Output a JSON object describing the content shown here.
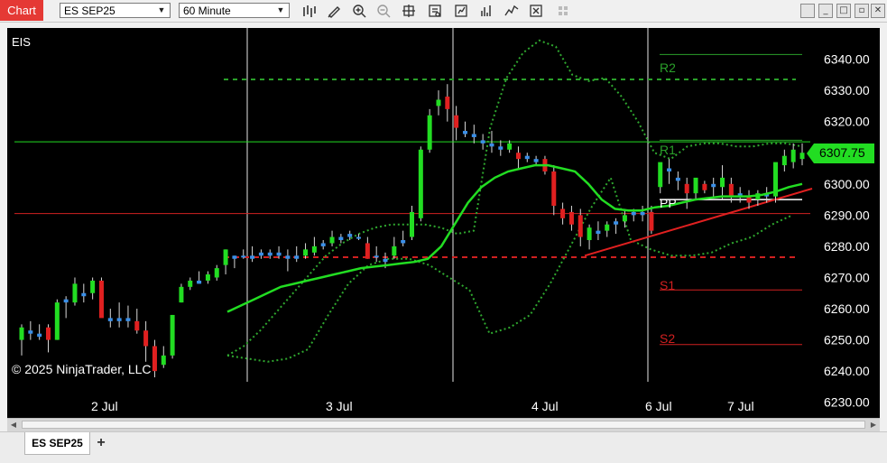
{
  "toolbar": {
    "chart_label": "Chart",
    "instrument": "ES SEP25",
    "interval": "60 Minute",
    "icons": [
      "bar-type-icon",
      "pencil-drawing-icon",
      "zoom-in-icon",
      "zoom-out-icon",
      "crosshair-icon",
      "data-box-icon",
      "strategies-icon",
      "indicators-icon",
      "chart-trader-icon",
      "properties-icon",
      "window-link-icon"
    ]
  },
  "window_controls": {
    "minimize": "_",
    "maximize": "□",
    "close": "✕"
  },
  "chart": {
    "instrument_label": "EIS",
    "copyright": "© 2025 NinjaTrader, LLC",
    "current_price_label": "6307.75",
    "pivot_labels": {
      "r2": "R2",
      "r1": "R1",
      "pp": "PP",
      "s1": "S1",
      "s2": "S2"
    },
    "pivot_levels": {
      "r2": 6341.5,
      "r1": 6314,
      "pp": 6295,
      "s1": 6266,
      "s2": 6248.5
    },
    "horizontal_lines": {
      "green_dashed": 6333.5,
      "green_solid": 6313.5,
      "red_solid": 6290.5,
      "red_dashed": 6276.5
    },
    "price_ticks": [
      "6340.00",
      "6330.00",
      "6320.00",
      "6310.00",
      "6300.00",
      "6290.00",
      "6280.00",
      "6270.00",
      "6260.00",
      "6250.00",
      "6240.00",
      "6230.00"
    ],
    "date_labels": [
      "2 Jul",
      "3 Jul",
      "4 Jul",
      "6 Jul",
      "7 Jul"
    ],
    "colors": {
      "up": "#22dd22",
      "down": "#e02020",
      "doji": "#3a8fe8",
      "ma": "#22dd22",
      "band": "#2fa82f",
      "pivot_green": "#2aa02a",
      "pivot_red": "#d02020",
      "support": "#e02020"
    }
  },
  "chart_data": {
    "type": "candlestick",
    "y_axis": {
      "min": 6225,
      "max": 6350
    },
    "bars": [
      [
        6250,
        6255,
        6245,
        6254
      ],
      [
        6253,
        6256,
        6250,
        6252
      ],
      [
        6252,
        6255,
        6250,
        6251
      ],
      [
        6254,
        6255,
        6246,
        6250
      ],
      [
        6250,
        6263,
        6250,
        6262
      ],
      [
        6262,
        6264,
        6257,
        6263
      ],
      [
        6262,
        6270,
        6261,
        6268
      ],
      [
        6265,
        6268,
        6262,
        6264
      ],
      [
        6265,
        6270,
        6263,
        6269
      ],
      [
        6269,
        6270,
        6259,
        6257
      ],
      [
        6257,
        6260,
        6254,
        6256
      ],
      [
        6257,
        6262,
        6254,
        6256
      ],
      [
        6257,
        6261,
        6254,
        6256
      ],
      [
        6256,
        6260,
        6252,
        6253
      ],
      [
        6253,
        6256,
        6243,
        6248
      ],
      [
        6248,
        6250,
        6238,
        6240
      ],
      [
        6242,
        6248,
        6241,
        6245
      ],
      [
        6245,
        6258,
        6244,
        6258
      ],
      [
        6262,
        6268,
        6262,
        6267
      ],
      [
        6267,
        6270,
        6266,
        6269
      ],
      [
        6268,
        6272,
        6268,
        6269
      ],
      [
        6269,
        6272,
        6268,
        6271
      ],
      [
        6270,
        6274,
        6269,
        6273
      ],
      [
        6274,
        6279,
        6271,
        6279
      ],
      [
        6276,
        6277,
        6273,
        6277
      ],
      [
        6277,
        6279,
        6276,
        6277
      ],
      [
        6276,
        6280,
        6275,
        6277
      ],
      [
        6277,
        6279,
        6276,
        6278
      ],
      [
        6277,
        6279,
        6276,
        6278
      ],
      [
        6278,
        6280,
        6276,
        6277
      ],
      [
        6277,
        6279,
        6272,
        6276
      ],
      [
        6276,
        6280,
        6275,
        6277
      ],
      [
        6277,
        6281,
        6276,
        6279
      ],
      [
        6278,
        6283,
        6277,
        6280
      ],
      [
        6280,
        6282,
        6279,
        6281
      ],
      [
        6281,
        6285,
        6280,
        6283
      ],
      [
        6282,
        6284,
        6281,
        6283
      ],
      [
        6284,
        6285,
        6282,
        6283
      ],
      [
        6283,
        6284,
        6282,
        6283
      ],
      [
        6281,
        6283,
        6276,
        6276
      ],
      [
        6277,
        6280,
        6275,
        6277
      ],
      [
        6275,
        6278,
        6273,
        6276
      ],
      [
        6277,
        6283,
        6276,
        6280
      ],
      [
        6281,
        6285,
        6280,
        6282
      ],
      [
        6283,
        6293,
        6282,
        6291
      ],
      [
        6289,
        6312,
        6288,
        6311
      ],
      [
        6311,
        6324,
        6310,
        6322
      ],
      [
        6325,
        6330,
        6322,
        6327
      ],
      [
        6328,
        6332,
        6320,
        6324
      ],
      [
        6322,
        6325,
        6314,
        6318
      ],
      [
        6317,
        6320,
        6315,
        6316
      ],
      [
        6316,
        6319,
        6313,
        6315
      ],
      [
        6314,
        6316,
        6311,
        6313
      ],
      [
        6313,
        6317,
        6310,
        6312
      ],
      [
        6312,
        6314,
        6309,
        6311
      ],
      [
        6311,
        6314,
        6310,
        6313
      ],
      [
        6310,
        6312,
        6305,
        6308
      ],
      [
        6308,
        6310,
        6307,
        6309
      ],
      [
        6308,
        6309,
        6306,
        6307
      ],
      [
        6308,
        6309,
        6303,
        6304
      ],
      [
        6304,
        6306,
        6290,
        6293
      ],
      [
        6292,
        6294,
        6287,
        6289
      ],
      [
        6291,
        6293,
        6285,
        6287
      ],
      [
        6290,
        6292,
        6280,
        6283
      ],
      [
        6282,
        6287,
        6279,
        6286
      ],
      [
        6284,
        6288,
        6282,
        6285
      ],
      [
        6285,
        6288,
        6283,
        6287
      ],
      [
        6287,
        6289,
        6284,
        6288
      ],
      [
        6288,
        6292,
        6286,
        6290
      ],
      [
        6290,
        6292,
        6288,
        6291
      ],
      [
        6291,
        6293,
        6288,
        6290
      ],
      [
        6291,
        6293,
        6284,
        6285
      ],
      [
        6299,
        6305,
        6297,
        6307
      ],
      [
        6305,
        6308,
        6300,
        6304
      ],
      [
        6302,
        6304,
        6298,
        6301
      ],
      [
        6300,
        6302,
        6292,
        6297
      ],
      [
        6297,
        6301,
        6295,
        6302
      ],
      [
        6300,
        6301,
        6297,
        6298
      ],
      [
        6300,
        6302,
        6296,
        6299
      ],
      [
        6299,
        6306,
        6295,
        6302
      ],
      [
        6300,
        6302,
        6294,
        6296
      ],
      [
        6296,
        6299,
        6294,
        6297
      ],
      [
        6296,
        6298,
        6292,
        6294
      ],
      [
        6295,
        6298,
        6293,
        6297
      ],
      [
        6297,
        6299,
        6294,
        6296
      ],
      [
        6296,
        6301,
        6294,
        6307
      ],
      [
        6306,
        6311,
        6304,
        6309
      ],
      [
        6307,
        6313,
        6305,
        6311
      ],
      [
        6308,
        6313,
        6306,
        6310
      ]
    ],
    "sma": [
      6259,
      6261,
      6263,
      6265,
      6267,
      6268,
      6269,
      6270,
      6271,
      6272,
      6273,
      6273.5,
      6274,
      6274.5,
      6275,
      6276,
      6280,
      6287,
      6294,
      6299,
      6302,
      6304,
      6305,
      6306,
      6306,
      6305,
      6304,
      6300,
      6295,
      6292,
      6291.5,
      6291.5,
      6292.5,
      6293,
      6294,
      6295,
      6295.5,
      6296,
      6296,
      6296,
      6296.5,
      6297.5,
      6299,
      6300
    ],
    "upper_band": [
      6245,
      6248,
      6253,
      6259,
      6265,
      6271,
      6277,
      6281,
      6284,
      6286,
      6287,
      6287,
      6287,
      6286,
      6284,
      6285,
      6318,
      6334,
      6342,
      6346,
      6344,
      6335,
      6333,
      6334,
      6328,
      6320,
      6310,
      6308,
      6312,
      6313,
      6313,
      6312,
      6312,
      6313,
      6313,
      6312
    ],
    "lower_band": [
      6245,
      6244,
      6243,
      6244,
      6247,
      6258,
      6268,
      6274,
      6276,
      6276,
      6274,
      6270,
      6266,
      6252,
      6254,
      6258,
      6268,
      6280,
      6292,
      6302,
      6282,
      6279,
      6277,
      6277,
      6278,
      6281,
      6283,
      6287,
      6290
    ]
  }
}
